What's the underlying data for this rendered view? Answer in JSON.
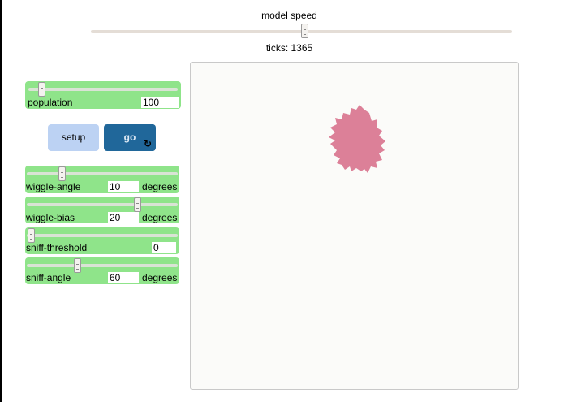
{
  "speed": {
    "label": "model speed",
    "ticks_text": "ticks: 1365",
    "value": 0.5
  },
  "population": {
    "label": "population",
    "value": "100",
    "fraction": 0.1
  },
  "buttons": {
    "setup": "setup",
    "go": "go",
    "go_forever_icon": "refresh-icon"
  },
  "wiggle_angle": {
    "label": "wiggle-angle",
    "value": "10",
    "units": "degrees",
    "fraction": 0.23
  },
  "wiggle_bias": {
    "label": "wiggle-bias",
    "value": "20",
    "units": "degrees",
    "fraction": 0.73
  },
  "sniff_threshold": {
    "label": "sniff-threshold",
    "value": "0",
    "fraction": 0.0
  },
  "sniff_angle": {
    "label": "sniff-angle",
    "value": "60",
    "units": "degrees",
    "fraction": 0.33
  },
  "colors": {
    "widget_green": "#8fe48a",
    "setup_blue": "#bcd2f3",
    "go_blue": "#20679a",
    "blob_pink": "#dc8098"
  }
}
